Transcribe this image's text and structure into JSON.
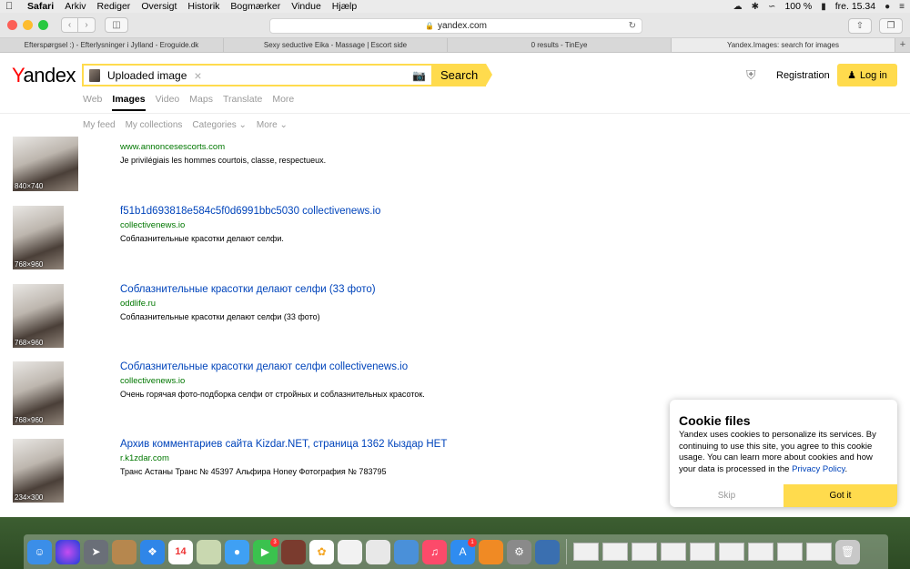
{
  "menubar": {
    "app": "Safari",
    "items": [
      "Arkiv",
      "Rediger",
      "Oversigt",
      "Historik",
      "Bogmærker",
      "Vindue",
      "Hjælp"
    ],
    "battery": "100 %",
    "clock": "fre. 15.34"
  },
  "browser": {
    "url": "yandex.com",
    "tabs": [
      "Efterspørgsel :) - Efterlysninger i Jylland - Eroguide.dk",
      "Sexy seductive Eika - Massage | Escort side",
      "0 results - TinEye",
      "Yandex.Images: search for images"
    ],
    "active_tab": 3
  },
  "header": {
    "logo": "Yandex",
    "search_label": "Uploaded image",
    "search_button": "Search",
    "registration": "Registration",
    "login": "Log in"
  },
  "services": [
    "Web",
    "Images",
    "Video",
    "Maps",
    "Translate",
    "More"
  ],
  "subnav": [
    "My feed",
    "My collections",
    "Categories",
    "More"
  ],
  "results": [
    {
      "title": "",
      "url": "www.annoncesescorts.com",
      "desc": "Je privilégiais les hommes courtois, classe, respectueux.",
      "dim": "840×740"
    },
    {
      "title": "f51b1d693818e584c5f0d6991bbc5030 collectivenews.io",
      "url": "collectivenews.io",
      "desc": "Соблазнительные красотки делают селфи.",
      "dim": "768×960"
    },
    {
      "title": "Соблазнительные красотки делают селфи (33 фото)",
      "url": "oddlife.ru",
      "desc": "Соблазнительные красотки делают селфи (33 фото)",
      "dim": "768×960"
    },
    {
      "title": "Соблазнительные красотки делают селфи collectivenews.io",
      "url": "collectivenews.io",
      "desc": "Очень горячая фото-подборка селфи от стройных и соблазнительных красоток.",
      "dim": "768×960"
    },
    {
      "title": "Архив комментариев сайта Kizdar.NET, страница 1362 Кыздар НЕТ",
      "url": "r.k1zdar.com",
      "desc": "Транс Астаны Транс № 45397 Альфира Honey Фотография № 783795",
      "dim": "234×300"
    }
  ],
  "cookie": {
    "title": "Cookie files",
    "text": "Yandex uses cookies to personalize its services. By continuing to use this site, you agree to this cookie usage. You can learn more about cookies and how your data is processed in the",
    "link": "Privacy Policy",
    "skip": "Skip",
    "got_it": "Got it"
  },
  "dock": {
    "calendar_day": "14",
    "facetime_badge": "3",
    "appstore_badge": "1"
  }
}
